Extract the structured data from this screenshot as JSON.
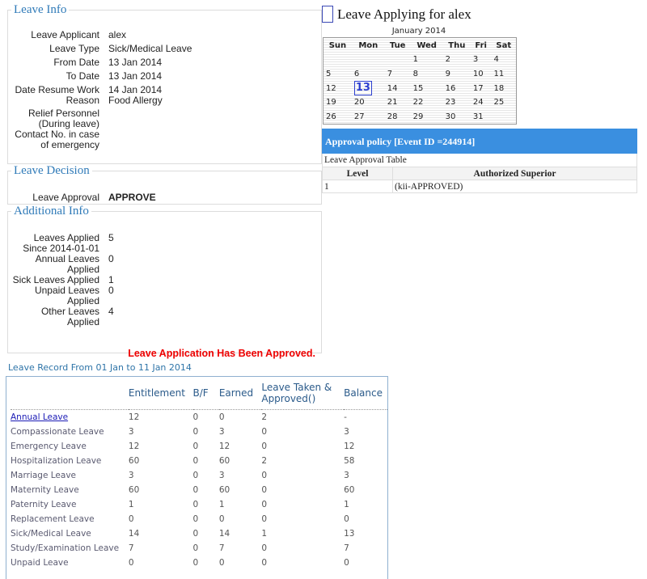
{
  "leave_info": {
    "legend": "Leave Info",
    "rows": [
      {
        "label": "Leave Applicant",
        "value": "alex"
      },
      {
        "label": "Leave Type",
        "value": "Sick/Medical Leave"
      },
      {
        "label": "From Date",
        "value": "13 Jan 2014"
      },
      {
        "label": "To Date",
        "value": "13 Jan 2014"
      },
      {
        "label": "Date Resume Work",
        "value": "14 Jan 2014"
      },
      {
        "label": "Reason",
        "value": "Food Allergy"
      },
      {
        "label": "Relief Personnel (During leave)",
        "value": ""
      },
      {
        "label": "Contact No. in case of emergency",
        "value": ""
      }
    ]
  },
  "leave_decision": {
    "legend": "Leave Decision",
    "label": "Leave Approval",
    "value": "APPROVE"
  },
  "additional_info": {
    "legend": "Additional Info",
    "rows": [
      {
        "label": "Leaves Applied Since 2014-01-01",
        "value": "5"
      },
      {
        "label": "Annual Leaves Applied",
        "value": "0"
      },
      {
        "label": "Sick Leaves Applied",
        "value": "1"
      },
      {
        "label": "Unpaid Leaves Applied",
        "value": "0"
      },
      {
        "label": "Other Leaves Applied",
        "value": "4"
      }
    ],
    "status_message": "Leave Application Has Been Approved."
  },
  "applying": {
    "title": "Leave Applying for alex"
  },
  "calendar": {
    "title": "January 2014",
    "weekdays": [
      "Sun",
      "Mon",
      "Tue",
      "Wed",
      "Thu",
      "Fri",
      "Sat"
    ],
    "weeks": [
      [
        "",
        "",
        "",
        "1",
        "2",
        "3",
        "4"
      ],
      [
        "5",
        "6",
        "7",
        "8",
        "9",
        "10",
        "11"
      ],
      [
        "12",
        "13",
        "14",
        "15",
        "16",
        "17",
        "18"
      ],
      [
        "19",
        "20",
        "21",
        "22",
        "23",
        "24",
        "25"
      ],
      [
        "26",
        "27",
        "28",
        "29",
        "30",
        "31",
        ""
      ]
    ],
    "selected": "13"
  },
  "approval_policy": {
    "header": "Approval policy [Event ID =244914]",
    "table_caption": "Leave Approval Table",
    "columns": [
      "Level",
      "Authorized Superior"
    ],
    "rows": [
      [
        "1",
        "(kii-APPROVED)"
      ]
    ]
  },
  "leave_record": {
    "title": "Leave Record From 01 Jan to 11 Jan 2014",
    "columns": [
      "",
      "Entitlement",
      "B/F",
      "Earned",
      "Leave Taken & Approved()",
      "Balance"
    ],
    "rows": [
      {
        "name": "Annual Leave",
        "link": true,
        "entitlement": "12",
        "bf": "0",
        "earned": "0",
        "taken": "2",
        "balance": "-"
      },
      {
        "name": "Compassionate Leave",
        "entitlement": "3",
        "bf": "0",
        "earned": "3",
        "taken": "0",
        "balance": "3"
      },
      {
        "name": "Emergency Leave",
        "entitlement": "12",
        "bf": "0",
        "earned": "12",
        "taken": "0",
        "balance": "12"
      },
      {
        "name": "Hospitalization Leave",
        "entitlement": "60",
        "bf": "0",
        "earned": "60",
        "taken": "2",
        "balance": "58"
      },
      {
        "name": "Marriage Leave",
        "entitlement": "3",
        "bf": "0",
        "earned": "3",
        "taken": "0",
        "balance": "3"
      },
      {
        "name": "Maternity Leave",
        "entitlement": "60",
        "bf": "0",
        "earned": "60",
        "taken": "0",
        "balance": "60"
      },
      {
        "name": "Paternity Leave",
        "entitlement": "1",
        "bf": "0",
        "earned": "1",
        "taken": "0",
        "balance": "1"
      },
      {
        "name": "Replacement Leave",
        "entitlement": "0",
        "bf": "0",
        "earned": "0",
        "taken": "0",
        "balance": "0"
      },
      {
        "name": "Sick/Medical Leave",
        "entitlement": "14",
        "bf": "0",
        "earned": "14",
        "taken": "1",
        "balance": "13"
      },
      {
        "name": "Study/Examination Leave",
        "entitlement": "7",
        "bf": "0",
        "earned": "7",
        "taken": "0",
        "balance": "7"
      },
      {
        "name": "Unpaid Leave",
        "entitlement": "0",
        "bf": "0",
        "earned": "0",
        "taken": "0",
        "balance": "0"
      }
    ]
  },
  "colors": {
    "legend": "#2f7ab8",
    "policy_header": "#3a8fe0",
    "approved_message": "#ee0000",
    "selected_day": "#2c3fd0",
    "link": "#1a1ab5"
  }
}
